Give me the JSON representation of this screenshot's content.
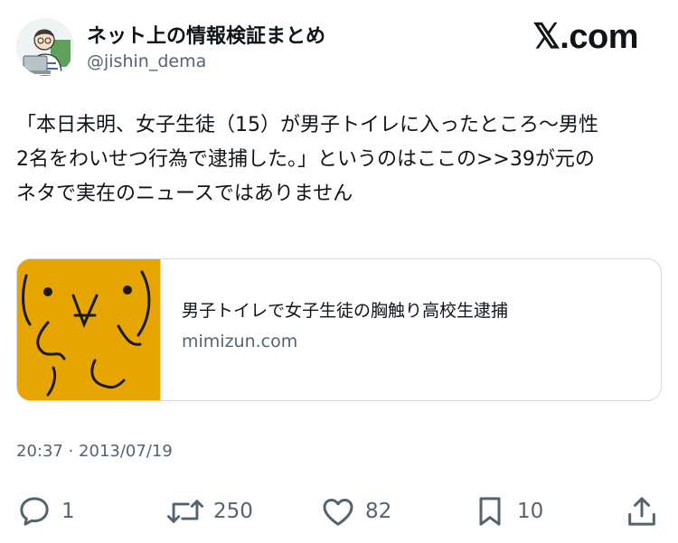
{
  "header": {
    "display_name": "ネット上の情報検証まとめ",
    "handle": "@jishin_dema",
    "logo_text": "𝕏.com",
    "avatar_icon": "avatar-person-with-laptop"
  },
  "tweet": {
    "lines": [
      "「本日未明、女子生徒（15）が男子トイレに入ったところ〜男性",
      "2名をわいせつ行為で逮捕した。」というのはここの>>39が元の",
      "ネタで実在のニュースではありません"
    ],
    "timestamp": "20:37 · 2013/07/19"
  },
  "card": {
    "title": "男子トイレで女子生徒の胸触り高校生逮捕",
    "domain": "mimizun.com",
    "thumb_color": "#e6a500"
  },
  "actions": {
    "reply_count": "1",
    "retweet_count": "250",
    "like_count": "82",
    "bookmark_count": "10"
  },
  "colors": {
    "text": "#0f1419",
    "secondary": "#536471",
    "border": "#cfd9de"
  }
}
